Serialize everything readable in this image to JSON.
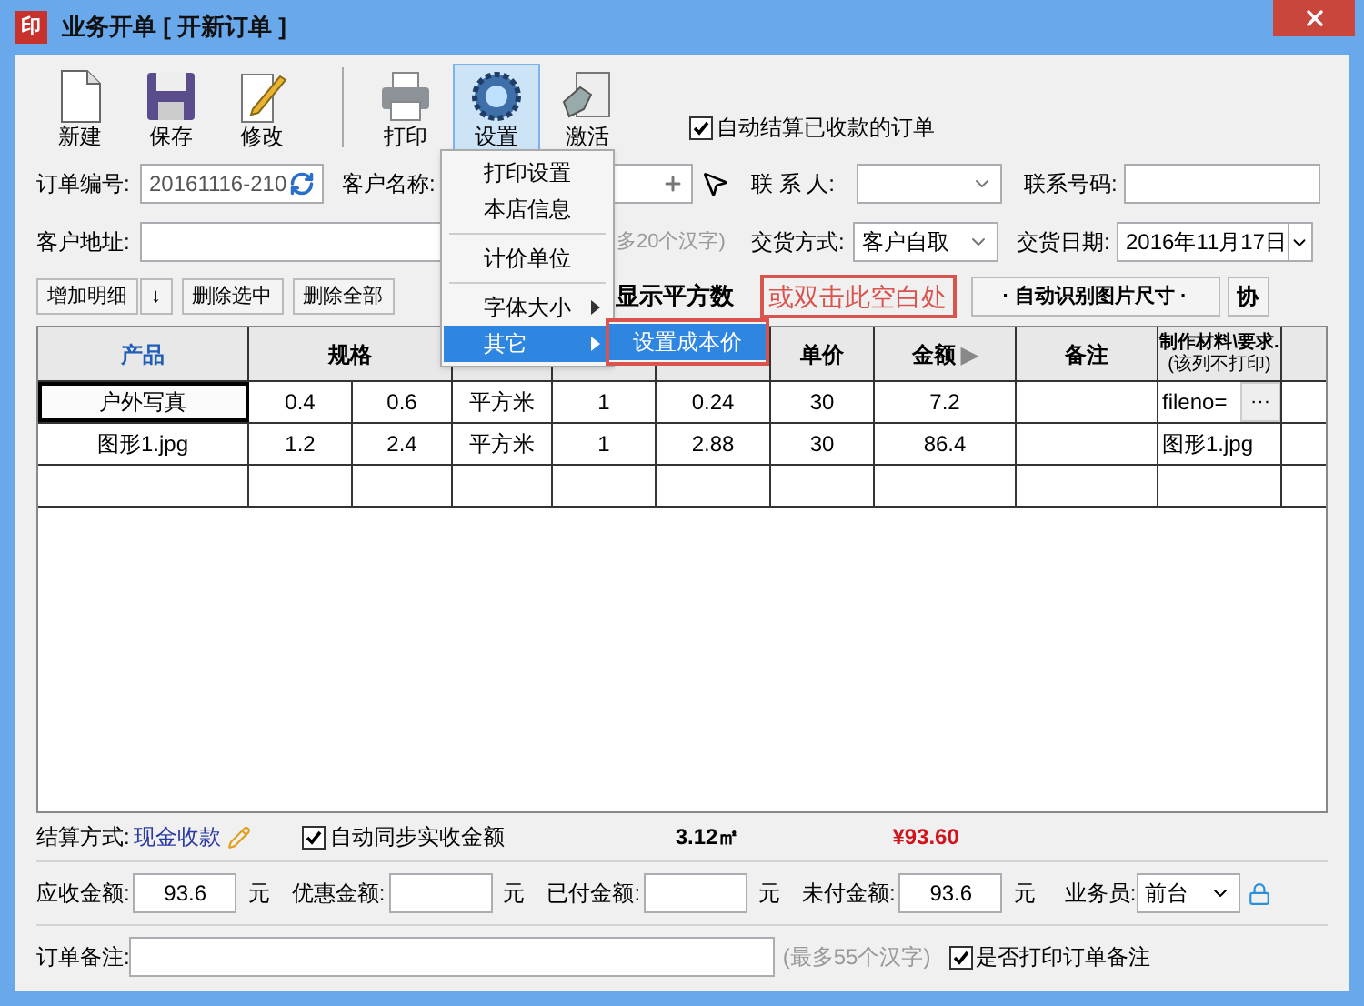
{
  "window": {
    "title": "业务开单 [ 开新订单 ]",
    "app_icon": "印"
  },
  "toolbar": [
    {
      "kind": "button",
      "label": "新建",
      "highlighted": false
    },
    {
      "kind": "button",
      "label": "保存",
      "highlighted": false
    },
    {
      "kind": "button",
      "label": "修改",
      "highlighted": false
    },
    {
      "kind": "separator"
    },
    {
      "kind": "button",
      "label": "打印",
      "highlighted": false
    },
    {
      "kind": "button",
      "label": "设置",
      "highlighted": true
    },
    {
      "kind": "button",
      "label": "激活",
      "highlighted": false
    }
  ],
  "auto_settle": {
    "label": "自动结算已收款的订单",
    "checked": true
  },
  "order_no": {
    "label": "订单编号:",
    "value": "20161116-210"
  },
  "customer_name": {
    "label": "客户名称:"
  },
  "contact": {
    "label": "联 系 人:"
  },
  "phone": {
    "label": "联系号码:"
  },
  "address": {
    "label": "客户地址:",
    "note": "多20个汉字)"
  },
  "delivery_method": {
    "label": "交货方式:",
    "value": "客户自取"
  },
  "delivery_date": {
    "label": "交货日期:",
    "value": "2016年11月17日"
  },
  "actions": [
    "增加明细",
    "↓",
    "删除选中",
    "删除全部"
  ],
  "show_area": {
    "label": "显示平方数"
  },
  "hint": "或双击此空白处",
  "auto_size_button": "· 自动识别图片尺寸 ·",
  "extra_button": "协",
  "table": {
    "columns": [
      {
        "label": "产品",
        "active": true
      },
      {
        "label": "规格",
        "active": false
      },
      {
        "merged": true
      },
      {},
      {},
      {},
      {
        "label": "单价",
        "active": false
      },
      {
        "label": "金额",
        "active": false,
        "mark": "▶"
      },
      {
        "label": "备注",
        "active": false
      },
      {
        "label": "制作材料\\要求.",
        "sublabel": "(该列不打印)",
        "active": false
      }
    ],
    "rows": [
      {
        "selected": true,
        "cells": [
          "户外写真",
          "0.4",
          "0.6",
          "平方米",
          "1",
          "0.24",
          "30",
          "7.2",
          "",
          "fileno="
        ],
        "more": "···"
      },
      {
        "selected": false,
        "cells": [
          "图形1.jpg",
          "1.2",
          "2.4",
          "平方米",
          "1",
          "2.88",
          "30",
          "86.4",
          "",
          "图形1.jpg"
        ]
      }
    ]
  },
  "menu": {
    "items": [
      {
        "kind": "item",
        "label": "打印设置",
        "submenu": false,
        "selected": false
      },
      {
        "kind": "item",
        "label": "本店信息",
        "submenu": false,
        "selected": false
      },
      {
        "kind": "separator"
      },
      {
        "kind": "item",
        "label": "计价单位",
        "submenu": false,
        "selected": false
      },
      {
        "kind": "separator"
      },
      {
        "kind": "item",
        "label": "字体大小",
        "submenu": true,
        "selected": false
      },
      {
        "kind": "item",
        "label": "其它",
        "submenu": true,
        "selected": true
      }
    ],
    "submenu": {
      "label": "设置成本价",
      "selected": true
    }
  },
  "summary": {
    "settle_label": "结算方式:",
    "settle_value": "现金收款",
    "sync": {
      "label": "自动同步实收金额",
      "checked": true
    },
    "area_total": "3.12㎡",
    "amount_total": "¥93.60"
  },
  "amounts": [
    {
      "label": "应收金额:",
      "value": "93.6",
      "unit": "元"
    },
    {
      "label": "优惠金额:",
      "unit": "元"
    },
    {
      "label": "已付金额:",
      "unit": "元"
    },
    {
      "label": "未付金额:",
      "value": "93.6",
      "unit": "元"
    }
  ],
  "salesperson": {
    "label": "业务员:",
    "value": "前台"
  },
  "remark": {
    "label": "订单备注:",
    "note": "(最多55个汉字)",
    "print": {
      "label": "是否打印订单备注",
      "checked": true
    }
  }
}
